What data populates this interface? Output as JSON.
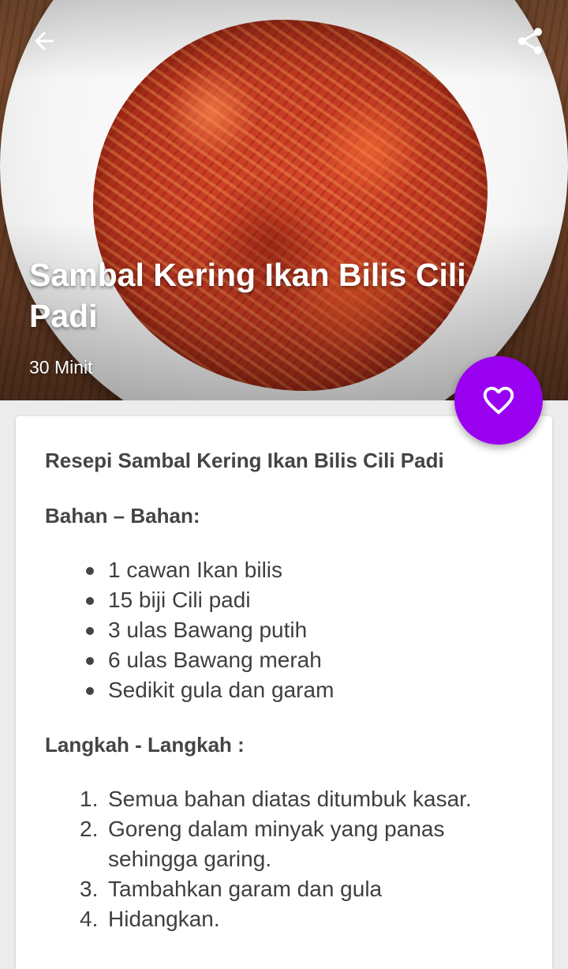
{
  "header": {
    "back_icon": "arrow-left-icon",
    "share_icon": "share-icon",
    "title": "Sambal Kering Ikan Bilis Cili Padi",
    "duration": "30 Minit"
  },
  "fab": {
    "icon": "heart-outline-icon",
    "color": "#9a00f0"
  },
  "content": {
    "recipe_heading": "Resepi Sambal Kering Ikan Bilis Cili Padi",
    "ingredients_heading": "Bahan – Bahan:",
    "ingredients": [
      "1 cawan Ikan bilis",
      "15 biji Cili padi",
      "3 ulas Bawang putih",
      "6 ulas Bawang merah",
      "Sedikit gula dan garam"
    ],
    "steps_heading": "Langkah - Langkah :",
    "steps": [
      {
        "num": "1.",
        "text": "Semua bahan diatas ditumbuk kasar."
      },
      {
        "num": "2.",
        "text": "Goreng dalam minyak yang panas sehingga garing."
      },
      {
        "num": "3.",
        "text": "Tambahkan garam dan gula"
      },
      {
        "num": "4.",
        "text": "Hidangkan."
      }
    ]
  }
}
